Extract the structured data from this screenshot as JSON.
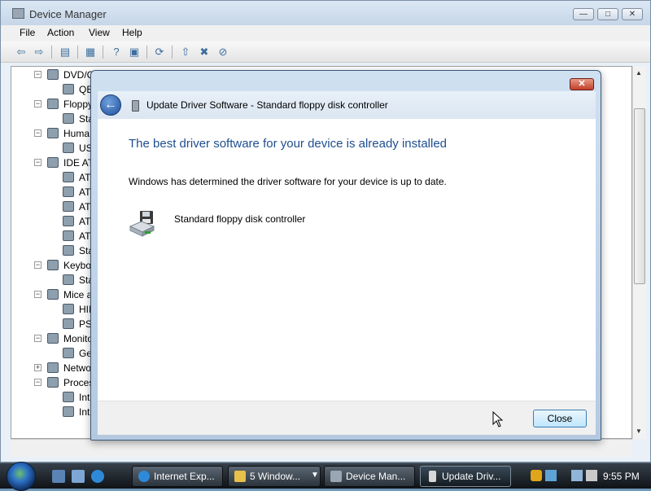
{
  "window": {
    "title": "Device Manager"
  },
  "menu": {
    "items": [
      "File",
      "Action",
      "View",
      "Help"
    ]
  },
  "tree": {
    "rows": [
      {
        "label": "DVD/C"
      },
      {
        "label": "QE"
      },
      {
        "label": "Floppy"
      },
      {
        "label": "Sta"
      },
      {
        "label": "Huma"
      },
      {
        "label": "US"
      },
      {
        "label": "IDE AT"
      },
      {
        "label": "AT"
      },
      {
        "label": "AT"
      },
      {
        "label": "AT"
      },
      {
        "label": "AT"
      },
      {
        "label": "AT"
      },
      {
        "label": "Sta"
      },
      {
        "label": "Keybo"
      },
      {
        "label": "Sta"
      },
      {
        "label": "Mice a"
      },
      {
        "label": "HII"
      },
      {
        "label": "PS,"
      },
      {
        "label": "Monito"
      },
      {
        "label": "Ge"
      },
      {
        "label": "Netwo"
      },
      {
        "label": "Proces"
      },
      {
        "label": "Int"
      },
      {
        "label": "Int"
      }
    ]
  },
  "dialog": {
    "title": "Update Driver Software - Standard floppy disk controller",
    "main_instruction": "The best driver software for your device is already installed",
    "description": "Windows has determined the driver software for your device is up to date.",
    "device_name": "Standard floppy disk controller",
    "close_button": "Close"
  },
  "taskbar": {
    "buttons": [
      {
        "label": "Internet Exp...",
        "icon": "internet-explorer-icon"
      },
      {
        "label": "5 Window...",
        "icon": "folder-icon"
      },
      {
        "label": "Device Man...",
        "icon": "device-manager-icon"
      },
      {
        "label": "Update Driv...",
        "icon": "update-driver-icon",
        "active": true
      }
    ],
    "clock": "9:55 PM"
  },
  "colors": {
    "instruction_blue": "#1f4e8f",
    "taskbar": "#1a2128"
  }
}
